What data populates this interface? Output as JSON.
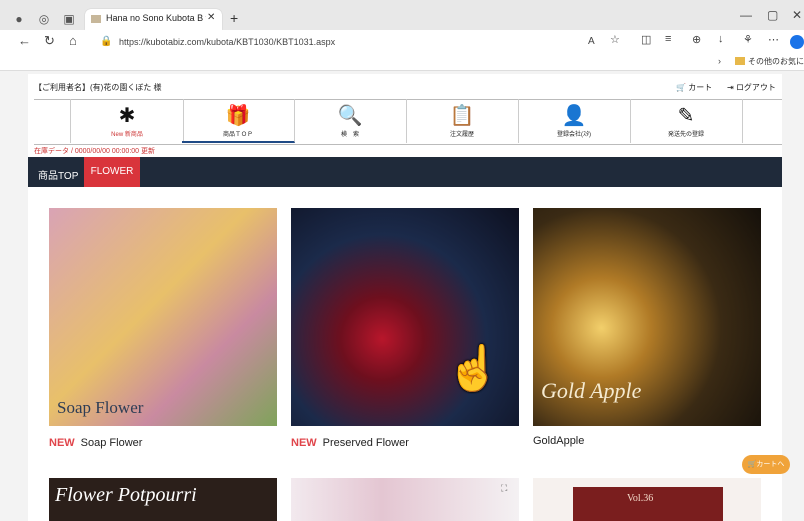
{
  "browser": {
    "tab_title": "Hana no Sono Kubota B to B On",
    "url": "https://kubotabiz.com/kubota/KBT1030/KBT1031.aspx",
    "favorites_label": "その他のお気に入り"
  },
  "header": {
    "user_line": "【ご利用者名】(有)花の園くぼた 様",
    "cart_label": "カート",
    "logout_label": "ログアウト"
  },
  "nav": [
    {
      "label": "New 新商品",
      "icon": "new-badge-icon",
      "glyph": "✱"
    },
    {
      "label": "商品ＴＯＰ",
      "icon": "gift-box-icon",
      "glyph": "🎁"
    },
    {
      "label": "検　索",
      "icon": "search-icon",
      "glyph": "🔍"
    },
    {
      "label": "注文履歴",
      "icon": "document-search-icon",
      "glyph": "📋"
    },
    {
      "label": "登録会社(ｽﾀ)",
      "icon": "person-icon",
      "glyph": "👤"
    },
    {
      "label": "発送先の登録",
      "icon": "edit-book-icon",
      "glyph": "✎"
    }
  ],
  "inventory_line": "在庫データ / 0000/00/00 00:00:00 更新",
  "breadcrumb": {
    "top": "商品TOP",
    "current": "FLOWER"
  },
  "products": [
    {
      "new": "NEW",
      "name": "Soap Flower",
      "overlay": "Soap Flower",
      "color": "#c98aa0"
    },
    {
      "new": "NEW",
      "name": "Preserved Flower",
      "overlay": "",
      "color": "#2a2d3e"
    },
    {
      "new": "",
      "name": "GoldApple",
      "overlay": "Gold Apple",
      "color": "#6b4a1c"
    }
  ],
  "row2": [
    {
      "overlay": "Flower Potpourri",
      "color": "#2b1f1a"
    },
    {
      "overlay": "",
      "color": "#e9e4ea"
    },
    {
      "overlay": "Vol.36",
      "color": "#7a1e1e"
    }
  ],
  "floating_cart": "カートへ"
}
